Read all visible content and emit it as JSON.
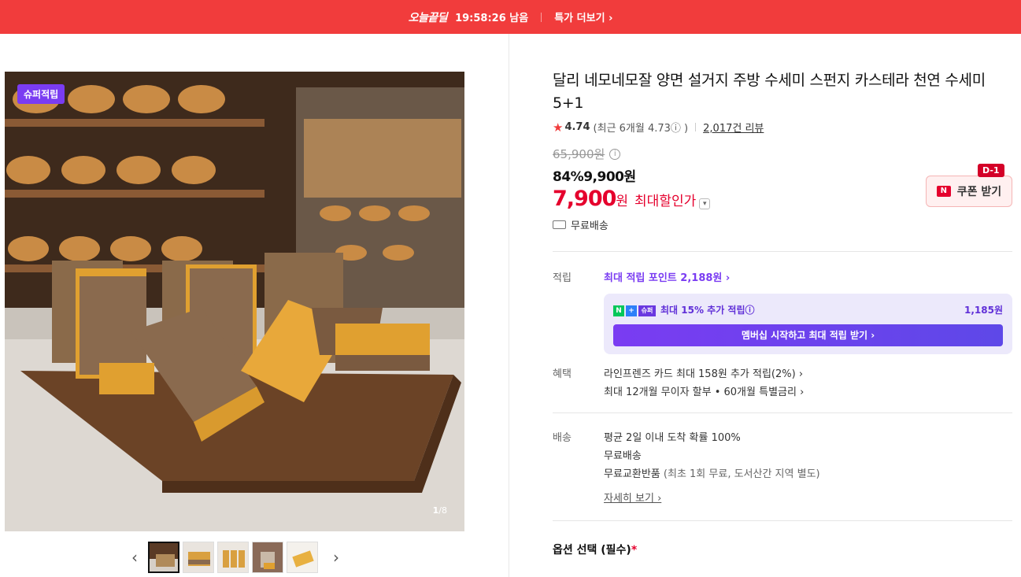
{
  "topbar": {
    "logo": "오늘끝딜",
    "timer": "19:58:26 남음",
    "more": "특가 더보기 ›"
  },
  "gallery": {
    "badge": "슈퍼적립",
    "counter_current": "1",
    "counter_total": "/8",
    "thumb_count": 5,
    "prev": "‹",
    "next": "›"
  },
  "product": {
    "title": "달리 네모네모잘 양면 설거지 주방 수세미 스펀지 카스테라 천연 수세미 5+1",
    "rating": "4.74",
    "recent": "(최근 6개월 4.73ⓘ )",
    "reviews": "2,017건 리뷰",
    "original_price": "65,900원",
    "discount": "84%",
    "sale_price": "9,900원",
    "final_price": "7,900",
    "final_unit": "원",
    "final_label": "최대할인가",
    "shipping": "무료배송",
    "coupon_tag": "D-1",
    "coupon_label": "쿠폰 받기",
    "coupon_logo": "N"
  },
  "points": {
    "label": "적립",
    "link": "최대 적립 포인트 2,188원 ›",
    "box_text": "최대 15% 추가 적립ⓘ",
    "box_amount": "1,185원",
    "button": "멤버십 시작하고 최대 적립 받기 ›",
    "icons": [
      "N",
      "+",
      "슈퍼"
    ]
  },
  "benefits": {
    "label": "혜택",
    "line1": "라인프렌즈 카드 최대 158원 추가 적립(2%) ›",
    "line2": "최대 12개월 무이자 할부 • 60개월 특별금리 ›"
  },
  "delivery": {
    "label": "배송",
    "line1": "평균 2일 이내 도착 확률 100%",
    "line2": "무료배송",
    "line3a": "무료교환반품 ",
    "line3b": "(최초 1회 무료, 도서산간 지역 별도)",
    "detail": "자세히 보기 ›"
  },
  "options": {
    "label": "옵션 선택 (필수)",
    "required": "*"
  }
}
